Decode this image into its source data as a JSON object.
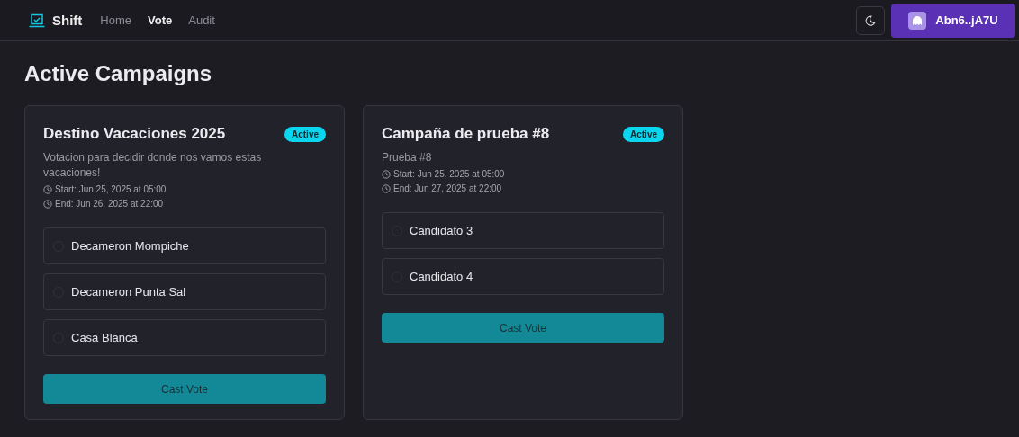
{
  "nav": {
    "brand": "Shift",
    "links": [
      {
        "label": "Home",
        "selected": false
      },
      {
        "label": "Vote",
        "selected": true
      },
      {
        "label": "Audit",
        "selected": false
      }
    ],
    "wallet": "Abn6..jA7U"
  },
  "title": "Active Campaigns",
  "campaigns": [
    {
      "name": "Destino Vacaciones 2025",
      "status": "Active",
      "description": "Votacion para decidir donde nos vamos estas vacaciones!",
      "start": "Start: Jun 25, 2025 at 05:00",
      "end": "End: Jun 26, 2025 at 22:00",
      "options": [
        {
          "label": "Decameron Mompiche",
          "selected": false
        },
        {
          "label": "Decameron Punta Sal",
          "selected": false
        },
        {
          "label": "Casa Blanca",
          "selected": false
        }
      ],
      "button": "Cast Vote"
    },
    {
      "name": "Campaña de prueba #8",
      "status": "Active",
      "description": "Prueba #8",
      "start": "Start: Jun 25, 2025 at 05:00",
      "end": "End: Jun 27, 2025 at 22:00",
      "options": [
        {
          "label": "Candidato 3",
          "selected": false
        },
        {
          "label": "Candidato 4",
          "selected": false
        }
      ],
      "button": "Cast Vote"
    }
  ]
}
